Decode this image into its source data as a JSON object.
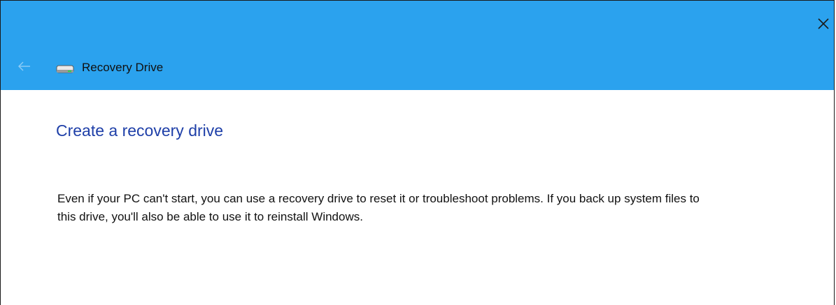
{
  "window": {
    "title": "Recovery Drive",
    "close_icon": "close-icon",
    "back_icon": "back-arrow-icon",
    "title_icon": "drive-icon"
  },
  "page": {
    "heading": "Create a recovery drive",
    "description": "Even if your PC can't start, you can use a recovery drive to reset it or troubleshoot problems. If you back up system files to this drive, you'll also be able to use it to reinstall Windows."
  },
  "colors": {
    "titlebar": "#2ba2ee",
    "heading": "#1e3fa8"
  }
}
